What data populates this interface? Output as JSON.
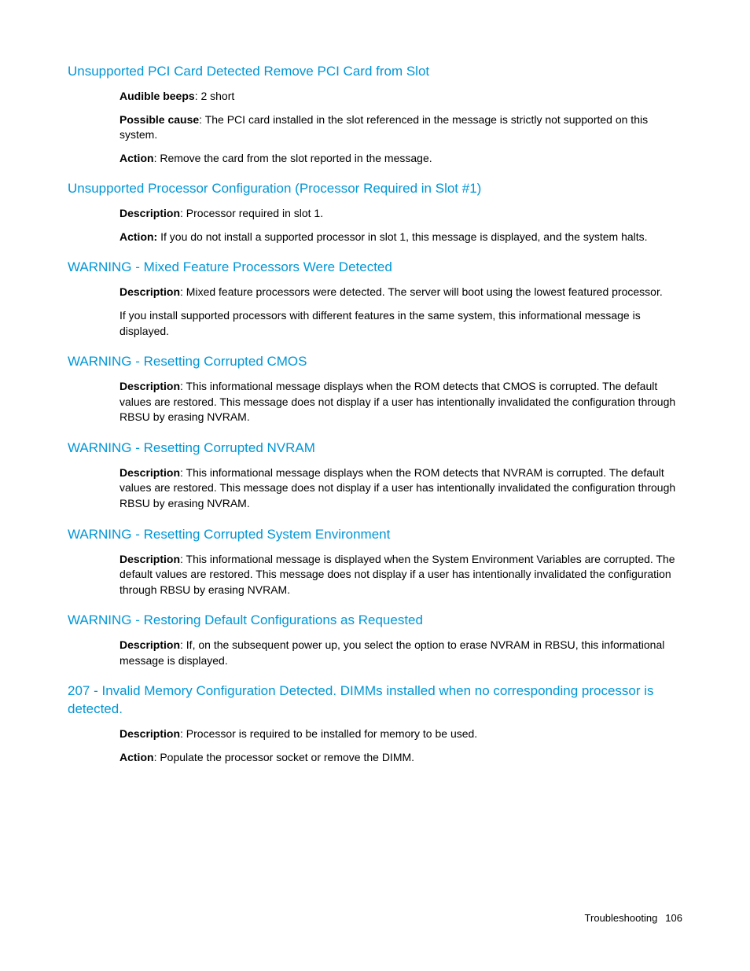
{
  "sections": [
    {
      "heading": "Unsupported PCI Card Detected Remove PCI Card from Slot",
      "paras": [
        {
          "label": "Audible beeps",
          "text": ": 2 short"
        },
        {
          "label": "Possible cause",
          "text": ": The PCI card installed in the slot referenced in the message is strictly not supported on this system."
        },
        {
          "label": "Action",
          "text": ": Remove the card from the slot reported in the message."
        }
      ]
    },
    {
      "heading": "Unsupported Processor Configuration (Processor Required in Slot #1)",
      "paras": [
        {
          "label": "Description",
          "text": ": Processor required in slot 1."
        },
        {
          "label": "Action:",
          "text": " If you do not install a supported processor in slot 1, this message is displayed, and the system halts."
        }
      ]
    },
    {
      "heading": "WARNING - Mixed Feature Processors Were Detected",
      "paras": [
        {
          "label": "Description",
          "text": ": Mixed feature processors were detected. The server will boot using the lowest featured processor."
        },
        {
          "label": "",
          "text": "If you install supported processors with different features in the same system, this informational message is displayed."
        }
      ]
    },
    {
      "heading": "WARNING - Resetting Corrupted CMOS",
      "paras": [
        {
          "label": "Description",
          "text": ": This informational message displays when the ROM detects that CMOS is corrupted. The default values are restored. This message does not display if a user has intentionally invalidated the configuration through RBSU by erasing NVRAM."
        }
      ]
    },
    {
      "heading": "WARNING - Resetting Corrupted NVRAM",
      "paras": [
        {
          "label": "Description",
          "text": ": This informational message displays when the ROM detects that NVRAM is corrupted. The default values are restored. This message does not display if a user has intentionally invalidated the configuration through RBSU by erasing NVRAM."
        }
      ]
    },
    {
      "heading": "WARNING - Resetting Corrupted System Environment",
      "paras": [
        {
          "label": "Description",
          "text": ": This informational message is displayed when the System Environment Variables are corrupted. The default values are restored. This message does not display if a user has intentionally invalidated the configuration through RBSU by erasing NVRAM."
        }
      ]
    },
    {
      "heading": "WARNING - Restoring Default Configurations as Requested",
      "paras": [
        {
          "label": "Description",
          "text": ": If, on the subsequent power up, you select the option to erase NVRAM in RBSU, this informational message is displayed."
        }
      ]
    },
    {
      "heading": "207 - Invalid Memory Configuration Detected. DIMMs installed when no corresponding processor is detected.",
      "paras": [
        {
          "label": "Description",
          "text": ": Processor is required to be installed for memory to be used."
        },
        {
          "label": "Action",
          "text": ": Populate the processor socket or remove the DIMM."
        }
      ]
    }
  ],
  "footer": {
    "label": "Troubleshooting",
    "page": "106"
  }
}
